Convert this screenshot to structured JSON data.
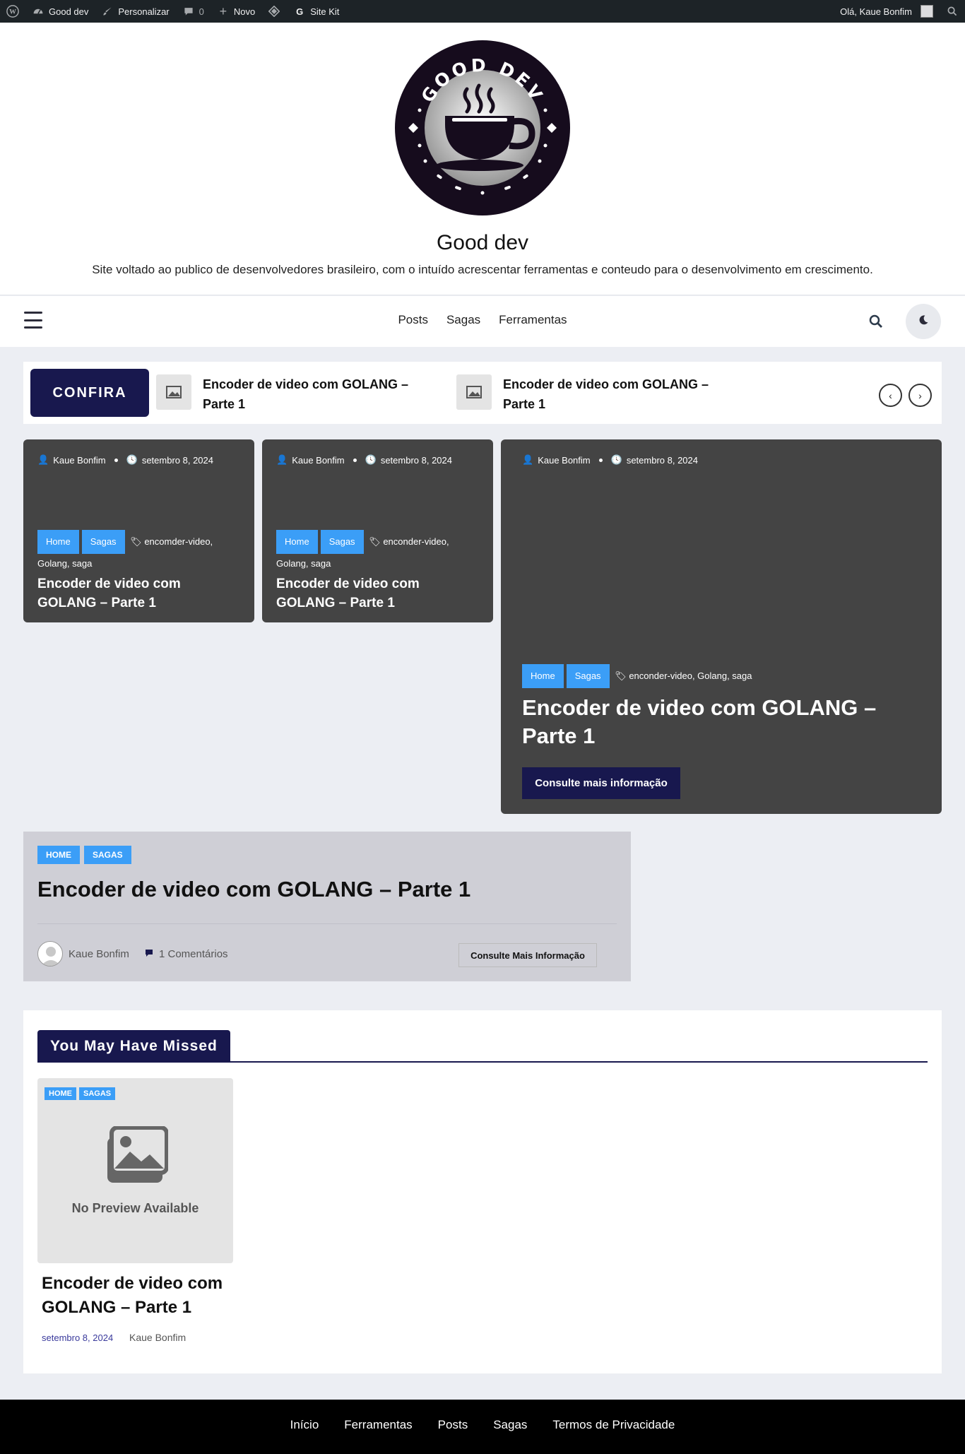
{
  "adminbar": {
    "site_name": "Good dev",
    "customize": "Personalizar",
    "comments_count": "0",
    "new": "Novo",
    "sitekit": "Site Kit",
    "greeting": "Olá, Kaue Bonfim"
  },
  "header": {
    "logo_text": "GOOD DEV",
    "title": "Good dev",
    "description": "Site voltado ao publico de desenvolvedores brasileiro, com o intuído acrescentar ferramentas e conteudo para o desenvolvimento em crescimento."
  },
  "nav": {
    "items": [
      "Posts",
      "Sagas",
      "Ferramentas"
    ]
  },
  "ticker": {
    "label": "CONFIRA",
    "items": [
      {
        "title": "Encoder de video com GOLANG – Parte 1"
      },
      {
        "title": "Encoder de video com GOLANG – Parte 1"
      }
    ]
  },
  "cards": [
    {
      "author": "Kaue Bonfim",
      "date": "setembro 8, 2024",
      "cats": [
        "Home",
        "Sagas"
      ],
      "tags": "encomder-video, Golang, saga",
      "title": "Encoder de video com GOLANG – Parte 1"
    },
    {
      "author": "Kaue Bonfim",
      "date": "setembro 8, 2024",
      "cats": [
        "Home",
        "Sagas"
      ],
      "tags": "enconder-video, Golang, saga",
      "title": "Encoder de video com GOLANG – Parte 1"
    },
    {
      "author": "Kaue Bonfim",
      "date": "setembro 8, 2024",
      "cats": [
        "Home",
        "Sagas"
      ],
      "tags": "enconder-video, Golang, saga",
      "title": "Encoder de video com GOLANG – Parte 1",
      "button": "Consulte mais informação"
    }
  ],
  "list_post": {
    "cats": [
      "HOME",
      "SAGAS"
    ],
    "title": "Encoder de video com GOLANG – Parte 1",
    "author": "Kaue Bonfim",
    "comments": "1 Comentários",
    "button": "Consulte Mais Informação"
  },
  "missed": {
    "heading": "You May Have Missed",
    "cats": [
      "HOME",
      "SAGAS"
    ],
    "no_preview": "No Preview Available",
    "title": "Encoder de video com GOLANG – Parte 1",
    "date": "setembro 8, 2024",
    "author": "Kaue Bonfim"
  },
  "footer": {
    "links": [
      "Início",
      "Ferramentas",
      "Posts",
      "Sagas",
      "Termos de Privacidade"
    ]
  }
}
